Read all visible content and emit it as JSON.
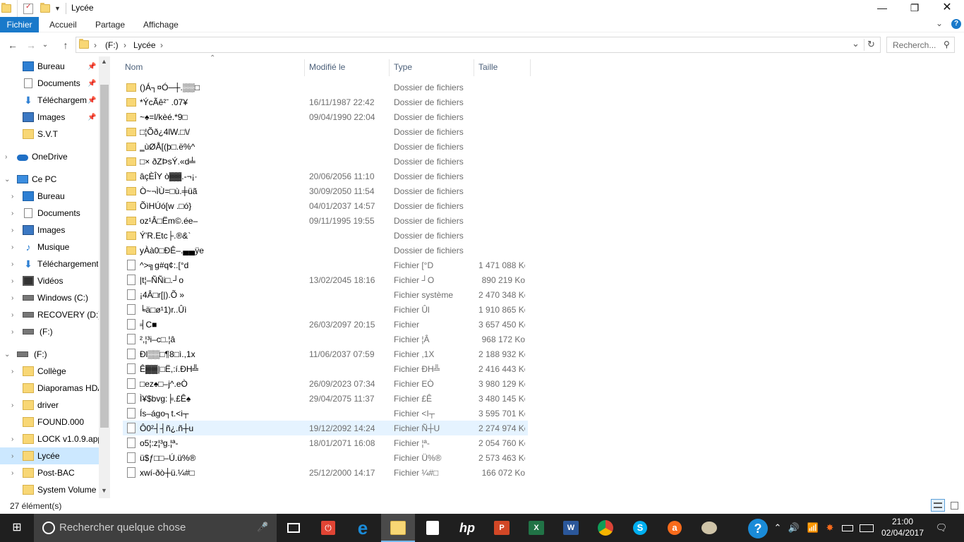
{
  "window": {
    "title": "Lycée",
    "minimize": "—",
    "maximize": "❐",
    "close": "✕"
  },
  "ribbon": {
    "tabs": [
      "Fichier",
      "Accueil",
      "Partage",
      "Affichage"
    ],
    "help_chevron": "⌄",
    "help": "?"
  },
  "address": {
    "back": "←",
    "forward": "→",
    "recent": "⌄",
    "up": "↑",
    "crumbs": [
      "(F:)",
      "›",
      "Lycée",
      "›"
    ],
    "lead_sep": "›",
    "dropdown": "⌄",
    "refresh": "↻",
    "search_placeholder": "Recherch...",
    "search_icon": "⚲"
  },
  "nav": {
    "items": [
      {
        "label": "Bureau",
        "icon": "desktop-icon",
        "pinned": true
      },
      {
        "label": "Documents",
        "icon": "documents-icon",
        "pinned": true
      },
      {
        "label": "Téléchargements",
        "icon": "download-icon",
        "pinned": true
      },
      {
        "label": "Images",
        "icon": "images-icon",
        "pinned": true
      },
      {
        "label": "S.V.T",
        "icon": "folder-icon",
        "pinned": false
      },
      {
        "label": "OneDrive",
        "icon": "onedrive-icon",
        "pinned": false
      },
      {
        "label": "Ce PC",
        "icon": "this-pc-icon",
        "pinned": false
      },
      {
        "label": "Bureau",
        "icon": "desktop-icon",
        "pinned": false
      },
      {
        "label": "Documents",
        "icon": "documents-icon",
        "pinned": false
      },
      {
        "label": "Images",
        "icon": "images-icon",
        "pinned": false
      },
      {
        "label": "Musique",
        "icon": "music-icon",
        "pinned": false
      },
      {
        "label": "Téléchargements",
        "icon": "download-icon",
        "pinned": false
      },
      {
        "label": "Vidéos",
        "icon": "videos-icon",
        "pinned": false
      },
      {
        "label": "Windows (C:)",
        "icon": "drive-icon",
        "pinned": false
      },
      {
        "label": "RECOVERY (D:)",
        "icon": "drive-icon",
        "pinned": false
      },
      {
        "label": "(F:)",
        "icon": "drive-icon",
        "pinned": false
      },
      {
        "label": "(F:)",
        "icon": "drive-icon",
        "pinned": false
      },
      {
        "label": "Collège",
        "icon": "folder-icon",
        "pinned": false
      },
      {
        "label": "Diaporamas HDA",
        "icon": "folder-icon",
        "pinned": false
      },
      {
        "label": "driver",
        "icon": "folder-icon",
        "pinned": false
      },
      {
        "label": "FOUND.000",
        "icon": "folder-icon",
        "pinned": false
      },
      {
        "label": "LOCK v1.0.9.app",
        "icon": "folder-icon",
        "pinned": false
      },
      {
        "label": "Lycée",
        "icon": "folder-icon",
        "pinned": false
      },
      {
        "label": "Post-BAC",
        "icon": "folder-icon",
        "pinned": false
      },
      {
        "label": "System Volume Information",
        "icon": "folder-icon",
        "pinned": false
      }
    ],
    "pin_glyph": "📌",
    "chevron_right": "›",
    "chevron_down": "⌄"
  },
  "columns": {
    "name": "Nom",
    "modified": "Modifié le",
    "type": "Type",
    "size": "Taille",
    "sort_glyph": "⌃"
  },
  "files": [
    {
      "name": "()Á┐¤Ó─┼.▒▒□",
      "date": "",
      "type": "Dossier de fichiers",
      "size": "",
      "kind": "folder"
    },
    {
      "name": "*ÝcÃê²ˉ .07¥",
      "date": "16/11/1987 22:42",
      "type": "Dossier de fichiers",
      "size": "",
      "kind": "folder"
    },
    {
      "name": "~♠=l/kèé.*9□",
      "date": "09/04/1990 22:04",
      "type": "Dossier de fichiers",
      "size": "",
      "kind": "folder"
    },
    {
      "name": "□¦Õð¿4lW.□\\/",
      "date": "",
      "type": "Dossier de fichiers",
      "size": "",
      "kind": "folder"
    },
    {
      "name": "‗ùØÅ[(þ□.ë%^",
      "date": "",
      "type": "Dossier de fichiers",
      "size": "",
      "kind": "folder"
    },
    {
      "name": "□× ðZÞsÝ.«d╧",
      "date": "",
      "type": "Dossier de fichiers",
      "size": "",
      "kind": "folder"
    },
    {
      "name": "âçÈÎY ò▓▓.-¬¡·",
      "date": "20/06/2056 11:10",
      "type": "Dossier de fichiers",
      "size": "",
      "kind": "folder"
    },
    {
      "name": "Ò~¬ÌÙ=□ù.╪üã",
      "date": "30/09/2050 11:54",
      "type": "Dossier de fichiers",
      "size": "",
      "kind": "folder"
    },
    {
      "name": "ÕìHÚó[w .□ó}",
      "date": "04/01/2037 14:57",
      "type": "Dossier de fichiers",
      "size": "",
      "kind": "folder"
    },
    {
      "name": "oz¹Â□Ëm©.ée‒",
      "date": "09/11/1995 19:55",
      "type": "Dossier de fichiers",
      "size": "",
      "kind": "folder"
    },
    {
      "name": "Ý'R.Etc├.®&`",
      "date": "",
      "type": "Dossier de fichiers",
      "size": "",
      "kind": "folder"
    },
    {
      "name": "yÀà0□ÐÊ‒.▄▄ÿe",
      "date": "",
      "type": "Dossier de fichiers",
      "size": "",
      "kind": "folder"
    },
    {
      "name": "^>╗g#q¢:.[°d",
      "date": "",
      "type": "Fichier [°D",
      "size": "1 471 088 Ko",
      "kind": "file"
    },
    {
      "name": "|t¦–ÑÑi□.┘o",
      "date": "13/02/2045 18:16",
      "type": "Fichier ┘O",
      "size": "890 219 Ko",
      "kind": "file"
    },
    {
      "name": "¡4Â□r[|).Õ »",
      "date": "",
      "type": "Fichier système",
      "size": "2 470 348 Ko",
      "kind": "sysfile"
    },
    {
      "name": "╘ä□ø¹1)r..Ûì",
      "date": "",
      "type": "Fichier Ûl",
      "size": "1 910 865 Ko",
      "kind": "file"
    },
    {
      "name": "╡C■",
      "date": "26/03/2097 20:15",
      "type": "Fichier",
      "size": "3 657 450 Ko",
      "kind": "file"
    },
    {
      "name": "²,¦³i–c□.¦â",
      "date": "",
      "type": "Fichier ¦Â",
      "size": "968 172 Ko",
      "kind": "file"
    },
    {
      "name": "Ðl▒▒□¶8□ì.,1x",
      "date": "11/06/2037 07:59",
      "type": "Fichier ,1X",
      "size": "2 188 932 Ko",
      "kind": "file"
    },
    {
      "name": "Ê▓▓|□Ë,:í.ÐH╩",
      "date": "",
      "type": "Fichier ÐH╩",
      "size": "2 416 443 Ko",
      "kind": "file"
    },
    {
      "name": "□ez♠□–j^.eÒ",
      "date": "26/09/2023 07:34",
      "type": "Fichier EÒ",
      "size": "3 980 129 Ko",
      "kind": "file"
    },
    {
      "name": "Ì¥$bvg:╞.£Ê♠",
      "date": "29/04/2075 11:37",
      "type": "Fichier £Ê",
      "size": "3 480 145 Ko",
      "kind": "file"
    },
    {
      "name": "Ís–ágo┐t.<i┬",
      "date": "",
      "type": "Fichier <I┬",
      "size": "3 595 701 Ko",
      "kind": "file"
    },
    {
      "name": "Ô0²┤┤ñ¿.ñ┼u",
      "date": "19/12/2092 14:24",
      "type": "Fichier Ñ┼U",
      "size": "2 274 974 Ko",
      "kind": "file"
    },
    {
      "name": "o5¦:z¦³g.¦ª-",
      "date": "18/01/2071 16:08",
      "type": "Fichier ¦ª-",
      "size": "2 054 760 Ko",
      "kind": "file"
    },
    {
      "name": "ü$ƒ□□–Ú.ü%®",
      "date": "",
      "type": "Fichier Ü%®",
      "size": "2 573 463 Ko",
      "kind": "file"
    },
    {
      "name": "xwí-ðò┼ü.¼#□",
      "date": "25/12/2000 14:17",
      "type": "Fichier ¼#□",
      "size": "166 072 Ko",
      "kind": "file"
    }
  ],
  "status": {
    "count": "27 élément(s)"
  },
  "taskbar": {
    "search_placeholder": "Rechercher quelque chose",
    "time": "21:00",
    "date": "02/04/2017",
    "start_glyph": "⊞",
    "mic_glyph": "🎤",
    "tray_help": "?",
    "tray_up": "⌃",
    "tray_volume": "🔊",
    "tray_wifi": "📶",
    "tray_notify": "🗨",
    "apps": [
      {
        "name": "task-view",
        "glyph": "▭"
      },
      {
        "name": "avast-app",
        "glyph": "⏻"
      },
      {
        "name": "edge",
        "glyph": "e"
      },
      {
        "name": "file-explorer",
        "glyph": "📁"
      },
      {
        "name": "store",
        "glyph": "🛍"
      },
      {
        "name": "hp-app",
        "glyph": "hp"
      },
      {
        "name": "powerpoint",
        "glyph": "P"
      },
      {
        "name": "excel",
        "glyph": "X"
      },
      {
        "name": "word",
        "glyph": "W"
      },
      {
        "name": "chrome",
        "glyph": "◉"
      },
      {
        "name": "skype",
        "glyph": "S"
      },
      {
        "name": "avast",
        "glyph": "a"
      },
      {
        "name": "paint",
        "glyph": "🎨"
      }
    ]
  }
}
